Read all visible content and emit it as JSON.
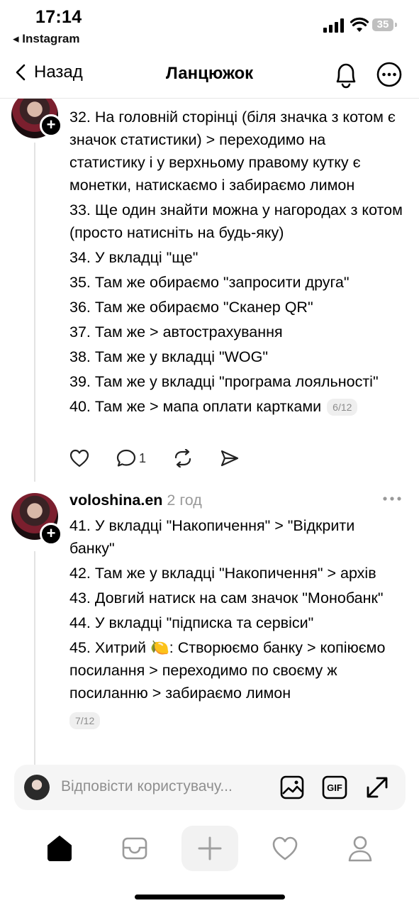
{
  "status_bar": {
    "time": "17:14",
    "back_app": "◂ Instagram",
    "battery": "35"
  },
  "header": {
    "back_label": "Назад",
    "title": "Ланцюжок"
  },
  "post1": {
    "lines": [
      "32. На головній сторінці (біля значка з котом є значок статистики) > переходимо на статистику і у верхньому правому кутку є монетки, натискаємо і забираємо лимон",
      "33. Ще один знайти можна у нагородах з котом (просто натисніть на будь-яку)",
      "34. У вкладці \"ще\"",
      "35. Там же обираємо \"запросити друга\"",
      "36. Там же обираємо \"Сканер QR\"",
      "37. Там же > автострахування",
      "38. Там же у вкладці \"WOG\"",
      "39. Там же у вкладці \"програма лояльності\"",
      "40. Там же > мапа оплати картками"
    ],
    "pager": "6/12",
    "reply_count": "1"
  },
  "post2": {
    "username": "voloshina.en",
    "time": "2 год",
    "lines": [
      "41. У вкладці \"Накопичення\" > \"Відкрити банку\"",
      "42. Там же у вкладці \"Накопичення\" > архів",
      "43. Довгий натиск на сам значок \"Монобанк\"",
      "44. У вкладці \"підписка та сервіси\"",
      "45. Хитрий 🍋: Створюємо банку > копіюємо посилання > переходимо по своєму ж посиланню > забираємо лимон"
    ],
    "pager": "7/12"
  },
  "reply_bar": {
    "placeholder": "Відповісти користувачу..."
  },
  "icons": {
    "home": "home-icon",
    "inbox": "inbox-icon",
    "create": "plus-icon",
    "activity": "heart-icon",
    "profile": "profile-icon"
  }
}
